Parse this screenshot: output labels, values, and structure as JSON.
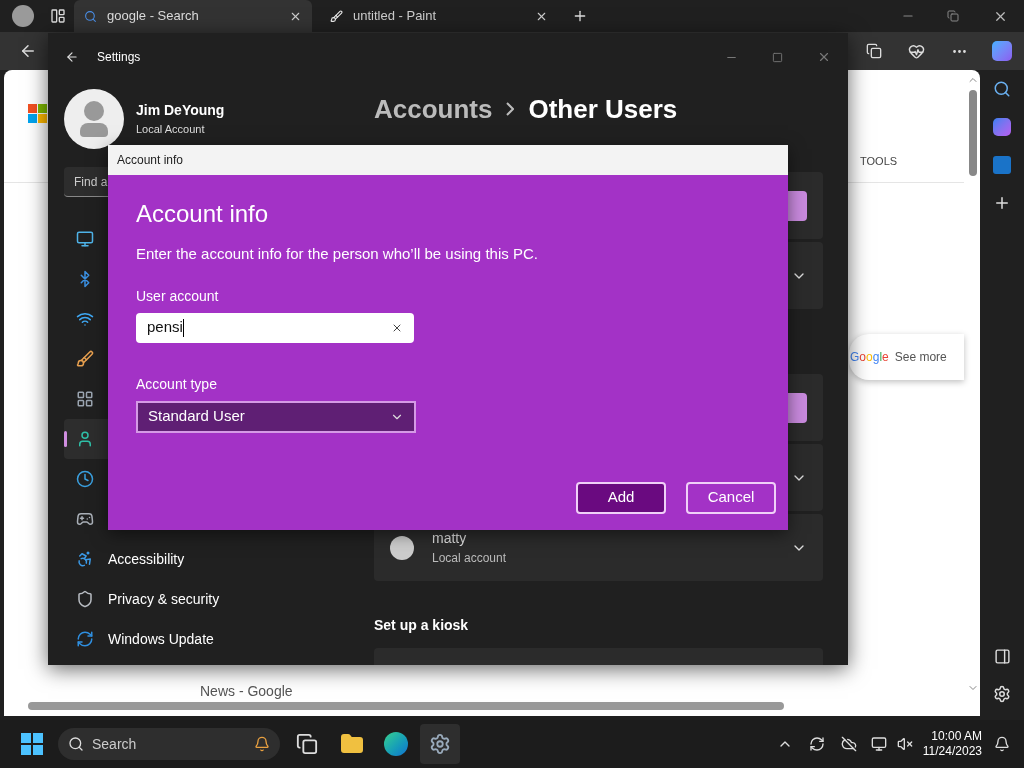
{
  "browser": {
    "tabs": [
      {
        "title": "google - Search",
        "kind": "search",
        "selected": true
      },
      {
        "title": "untitled - Paint",
        "kind": "paint",
        "selected": false
      }
    ],
    "page": {
      "tools": "TOOLS",
      "logo_text": "Google",
      "see_more": "See more",
      "news_source": "News - Google"
    }
  },
  "settings": {
    "title": "Settings",
    "user": {
      "name": "Jim DeYoung",
      "account": "Local Account"
    },
    "search_placeholder": "Find a",
    "nav": [
      {
        "kind": "system",
        "selected": false
      },
      {
        "kind": "bluetooth",
        "selected": false
      },
      {
        "kind": "network",
        "selected": false
      },
      {
        "kind": "personalization",
        "selected": false
      },
      {
        "kind": "apps",
        "selected": false
      },
      {
        "kind": "accounts",
        "selected": true
      },
      {
        "kind": "time",
        "selected": false
      },
      {
        "kind": "gaming",
        "selected": false
      },
      {
        "kind": "accessibility",
        "label": "Accessibility",
        "selected": false
      },
      {
        "kind": "privacy",
        "label": "Privacy & security",
        "selected": false
      },
      {
        "kind": "update",
        "label": "Windows Update",
        "selected": false
      }
    ],
    "breadcrumb": [
      "Accounts",
      "Other Users"
    ],
    "cards": [
      {
        "kind": "button"
      },
      {
        "kind": "chevron"
      },
      {
        "kind": "gap"
      },
      {
        "kind": "button"
      },
      {
        "kind": "chevron"
      },
      {
        "kind": "user",
        "name": "matty",
        "account": "Local account"
      }
    ],
    "kiosk": {
      "heading": "Set up a kiosk"
    }
  },
  "dialog": {
    "title": "Account info",
    "heading": "Account info",
    "description": "Enter the account info for the person who’ll be using this PC.",
    "user_label": "User account",
    "user_value": "pensi",
    "type_label": "Account type",
    "type_value": "Standard User",
    "buttons": [
      {
        "label": "Add",
        "kind": "primary"
      },
      {
        "label": "Cancel",
        "kind": "secondary"
      }
    ]
  },
  "taskbar": {
    "search": "Search",
    "time": "10:00 AM",
    "date": "11/24/2023"
  }
}
